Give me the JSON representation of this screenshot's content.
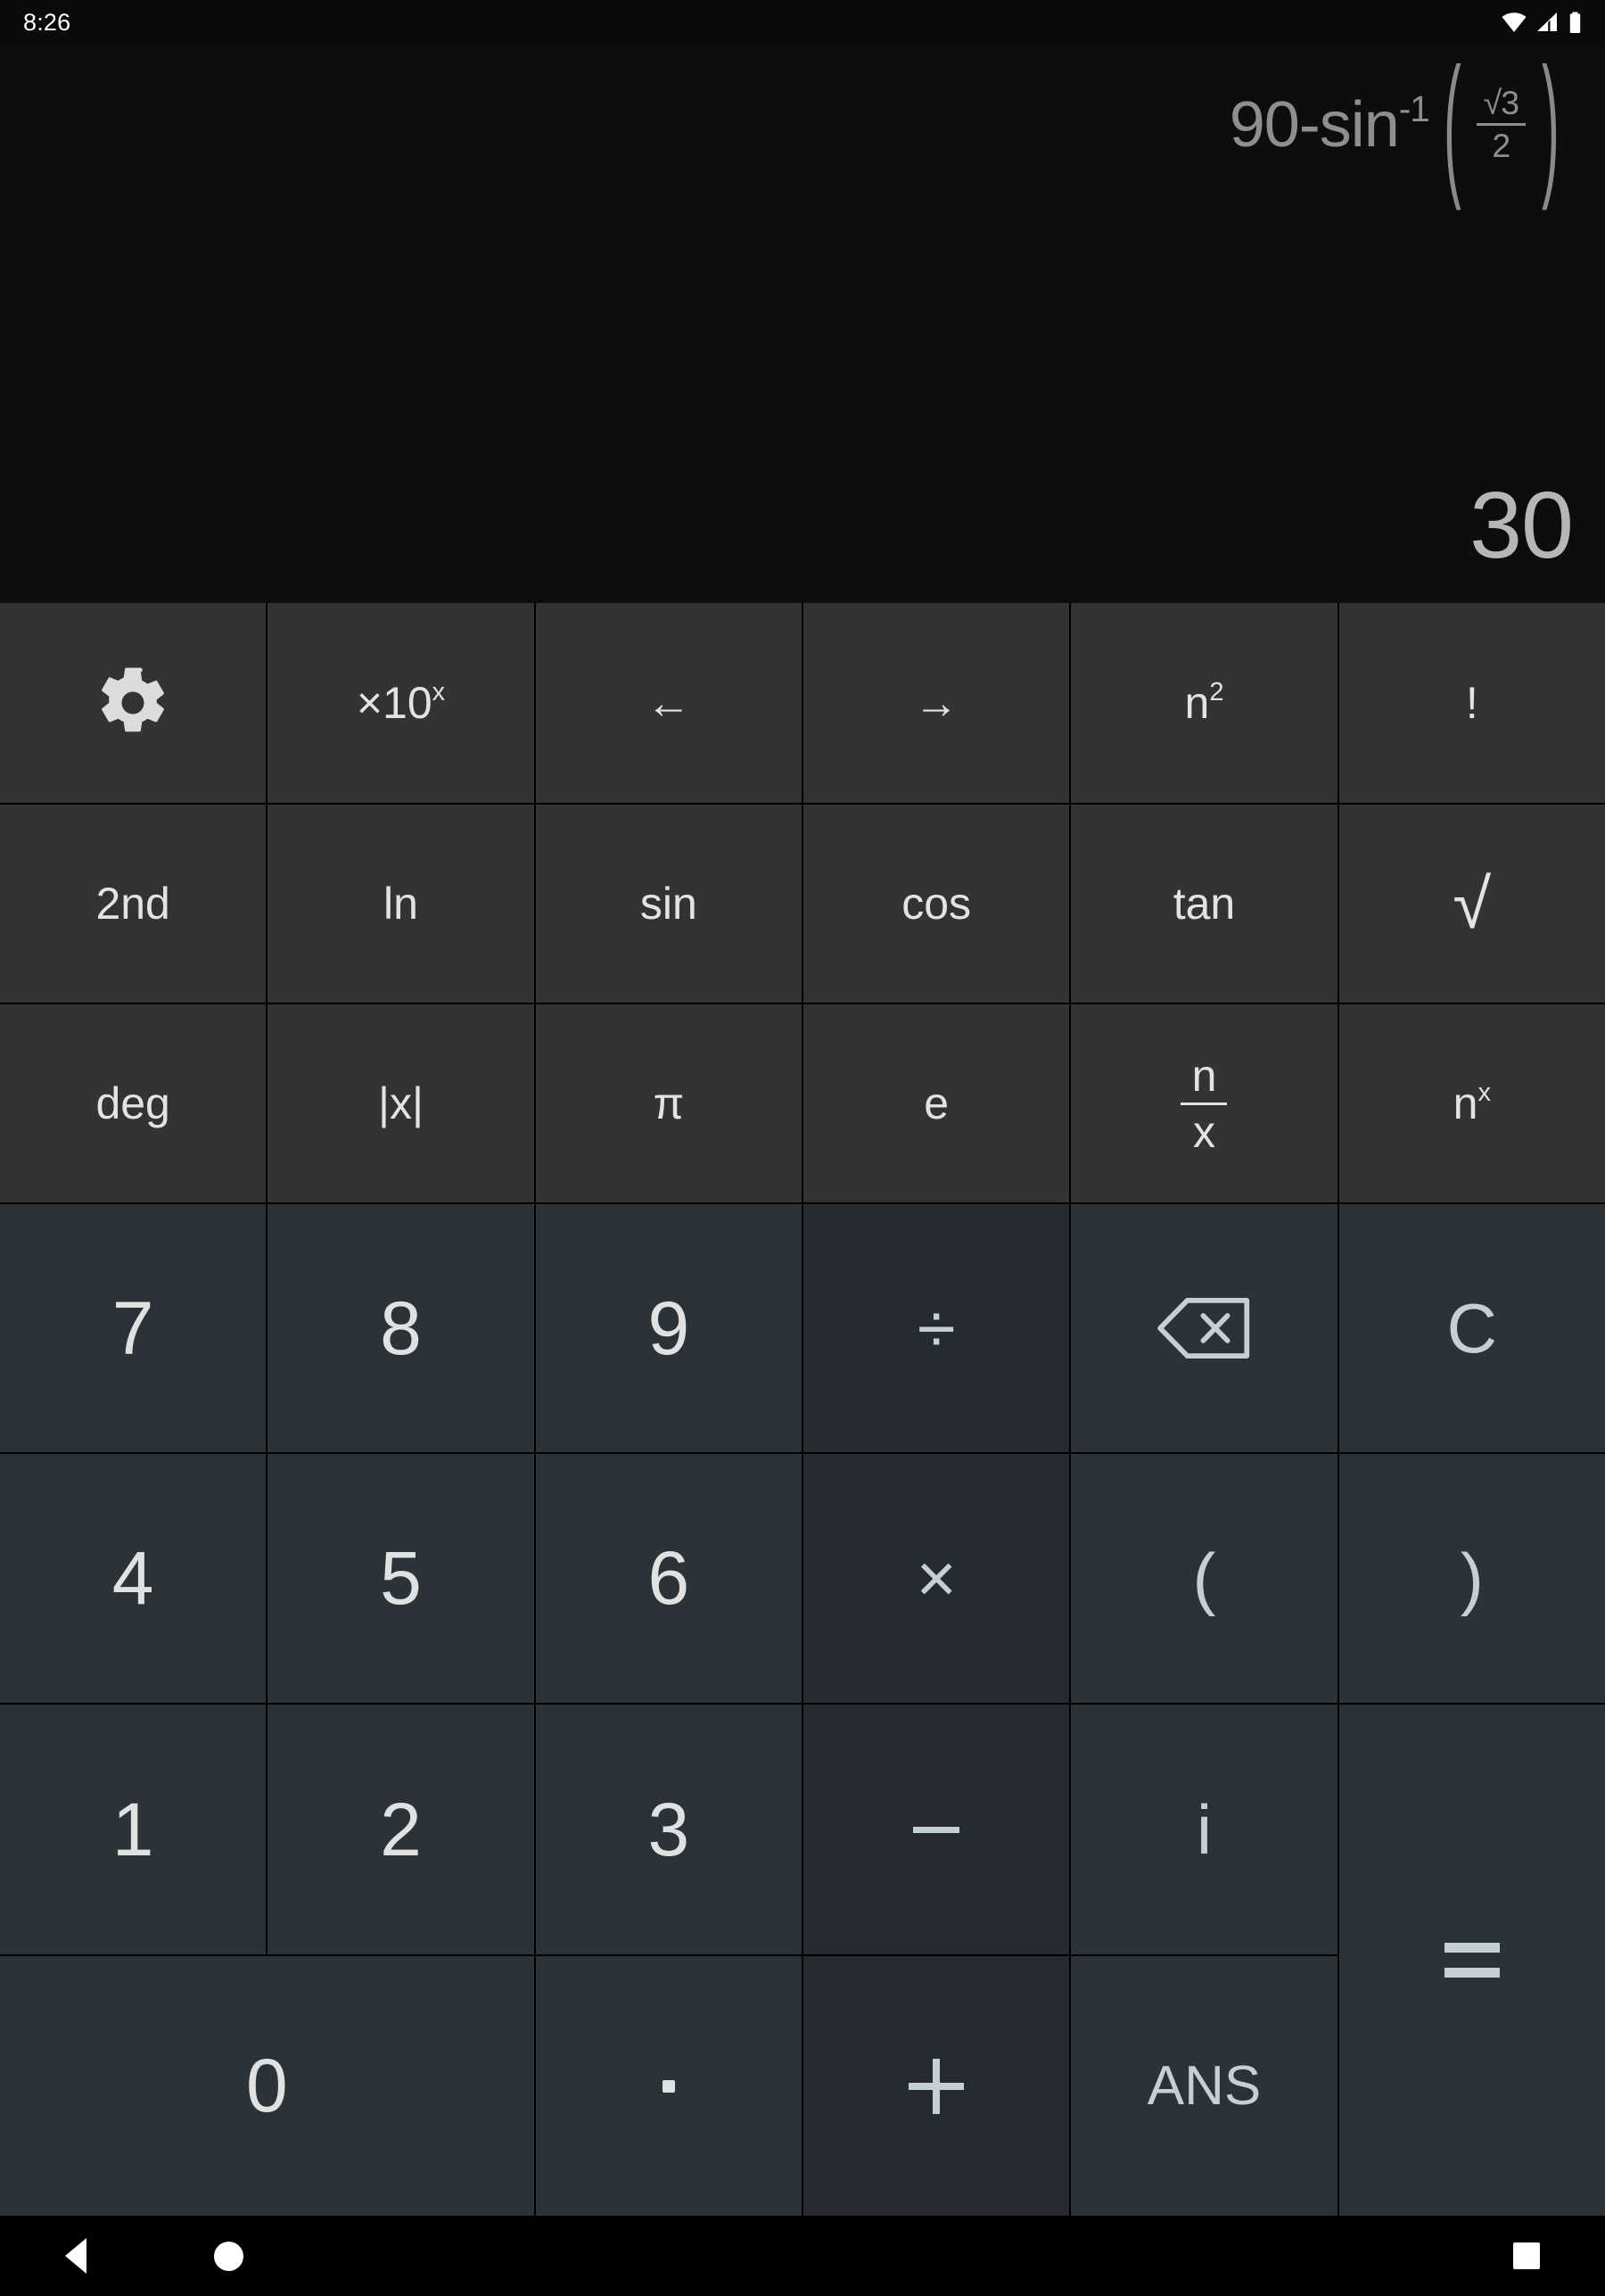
{
  "status_bar": {
    "time": "8:26",
    "icons": [
      "wifi-icon",
      "cellular-signal-icon",
      "battery-icon"
    ]
  },
  "display": {
    "expression_text": "90-sin⁻¹(√3/2)",
    "expression_parts": {
      "lead": "90-sin",
      "exponent": "-1",
      "open_paren": "(",
      "numerator": "√3",
      "denominator": "2",
      "close_paren": ")"
    },
    "result": "30"
  },
  "keypad": {
    "rows": [
      {
        "type": "function",
        "keys": [
          {
            "name": "settings-gear-button",
            "label": "",
            "icon": "gear-icon",
            "style": "fn"
          },
          {
            "name": "times-ten-power-x-button",
            "label": "×10",
            "sup": "x",
            "style": "fn"
          },
          {
            "name": "cursor-left-button",
            "label": "←",
            "style": "fn"
          },
          {
            "name": "cursor-right-button",
            "label": "→",
            "style": "fn"
          },
          {
            "name": "n-squared-button",
            "label": "n",
            "sup": "2",
            "style": "fn"
          },
          {
            "name": "factorial-button",
            "label": "!",
            "style": "fn"
          }
        ]
      },
      {
        "type": "function",
        "keys": [
          {
            "name": "second-function-button",
            "label": "2nd",
            "style": "fn"
          },
          {
            "name": "natural-log-button",
            "label": "ln",
            "style": "fn"
          },
          {
            "name": "sine-button",
            "label": "sin",
            "style": "fn"
          },
          {
            "name": "cosine-button",
            "label": "cos",
            "style": "fn"
          },
          {
            "name": "tangent-button",
            "label": "tan",
            "style": "fn"
          },
          {
            "name": "square-root-button",
            "label": "√",
            "style": "fn"
          }
        ]
      },
      {
        "type": "function",
        "keys": [
          {
            "name": "degree-mode-button",
            "label": "deg",
            "style": "fn"
          },
          {
            "name": "absolute-value-button",
            "label": "|x|",
            "style": "fn"
          },
          {
            "name": "pi-button",
            "label": "π",
            "style": "fn"
          },
          {
            "name": "euler-number-button",
            "label": "e",
            "style": "fn"
          },
          {
            "name": "fraction-n-over-x-button",
            "num": "n",
            "den": "x",
            "style": "fn"
          },
          {
            "name": "n-to-power-x-button",
            "label": "n",
            "sup": "x",
            "style": "fn"
          }
        ]
      },
      {
        "type": "numeric",
        "keys": [
          {
            "name": "digit-7-button",
            "label": "7",
            "style": "num"
          },
          {
            "name": "digit-8-button",
            "label": "8",
            "style": "num"
          },
          {
            "name": "digit-9-button",
            "label": "9",
            "style": "num"
          },
          {
            "name": "divide-button",
            "label": "÷",
            "style": "op"
          },
          {
            "name": "backspace-button",
            "label": "",
            "icon": "backspace-icon",
            "style": "side"
          },
          {
            "name": "clear-button",
            "label": "C",
            "style": "side"
          }
        ]
      },
      {
        "type": "numeric",
        "keys": [
          {
            "name": "digit-4-button",
            "label": "4",
            "style": "num"
          },
          {
            "name": "digit-5-button",
            "label": "5",
            "style": "num"
          },
          {
            "name": "digit-6-button",
            "label": "6",
            "style": "num"
          },
          {
            "name": "multiply-button",
            "label": "×",
            "style": "op"
          },
          {
            "name": "open-parenthesis-button",
            "label": "(",
            "style": "side"
          },
          {
            "name": "close-parenthesis-button",
            "label": ")",
            "style": "side"
          }
        ]
      },
      {
        "type": "numeric",
        "keys": [
          {
            "name": "digit-1-button",
            "label": "1",
            "style": "num"
          },
          {
            "name": "digit-2-button",
            "label": "2",
            "style": "num"
          },
          {
            "name": "digit-3-button",
            "label": "3",
            "style": "num"
          },
          {
            "name": "subtract-button",
            "label": "-",
            "style": "op"
          },
          {
            "name": "imaginary-unit-button",
            "label": "i",
            "style": "side"
          },
          {
            "name": "equals-button",
            "label": "=",
            "style": "side"
          }
        ]
      },
      {
        "type": "numeric",
        "keys": [
          {
            "name": "digit-0-button",
            "label": "0",
            "style": "num"
          },
          {
            "name": "decimal-point-button",
            "label": ".",
            "style": "num"
          },
          {
            "name": "add-button",
            "label": "+",
            "style": "op"
          },
          {
            "name": "answer-recall-button",
            "label": "ANS",
            "style": "side"
          }
        ]
      }
    ]
  },
  "navigation_bar": {
    "back": "back-nav-button",
    "home": "home-nav-button",
    "recents": "recents-nav-button"
  },
  "colors": {
    "display_bg": "#0d0d0d",
    "function_key_bg": "#333333",
    "numeric_key_bg": "#2b3338",
    "operator_key_bg": "#252b30",
    "expression_text": "#8e8e8e",
    "result_text": "#b6b6b6",
    "accent_text": "#c5d0d4"
  }
}
